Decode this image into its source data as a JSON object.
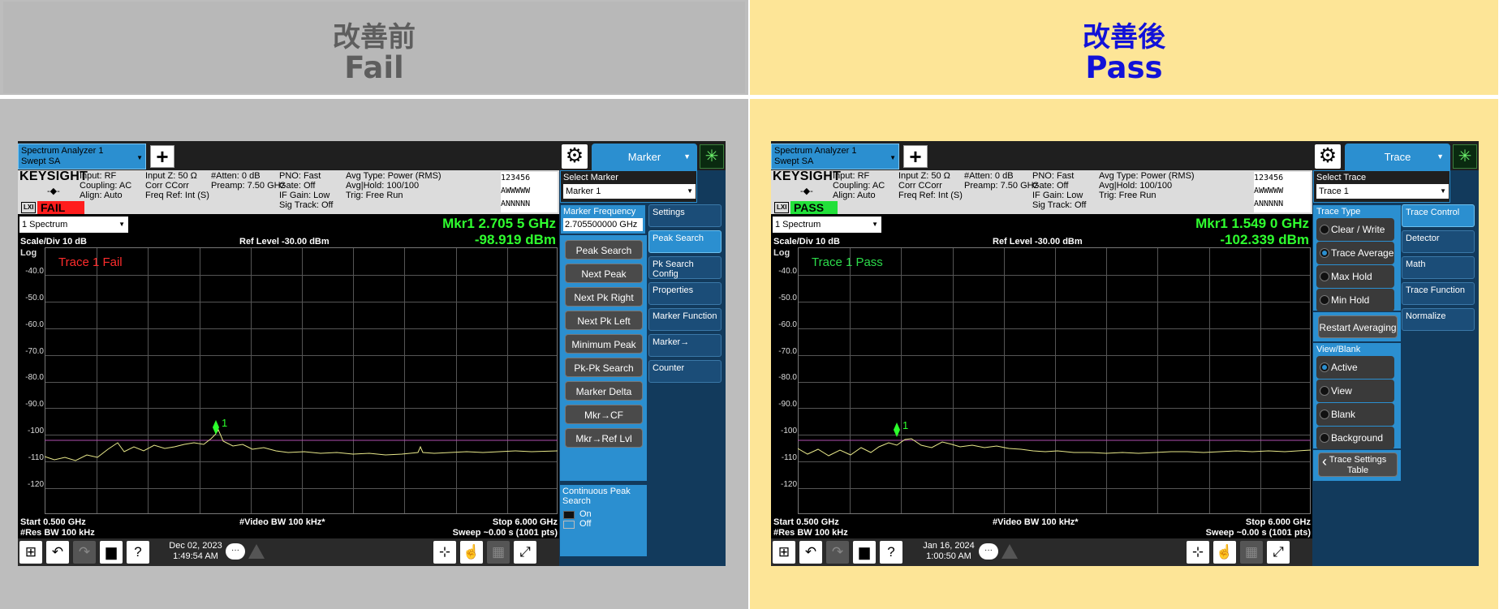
{
  "left": {
    "title_line1": "改善前",
    "title_line2": "Fail",
    "app_tab": "Spectrum Analyzer 1\nSwept SA",
    "menu": "Marker",
    "info": {
      "col1": "Input: RF\nCoupling: AC\nAlign: Auto",
      "col2": "Input Z: 50 Ω\nCorr CCorr\nFreq Ref: Int (S)",
      "col3": "#Atten: 0 dB\nPreamp: 7.50 GHz",
      "col4": "PNO: Fast\nGate: Off\nIF Gain: Low\nSig Track: Off",
      "col5": "Avg Type: Power (RMS)\nAvg|Hold: 100/100\nTrig: Free Run"
    },
    "status_badge": "FAIL",
    "view": "1 Spectrum",
    "marker_freq": "Mkr1  2.705 5 GHz",
    "marker_amp": "-98.919 dBm",
    "trace_label": "Trace 1 Fail",
    "marker_label": "1",
    "date": "Dec 02, 2023",
    "time": "1:49:54 AM",
    "select_title": "Select Marker",
    "select_value": "Marker 1",
    "mf_title": "Marker Frequency",
    "mf_value": "2.705500000 GHz",
    "actions": [
      "Peak Search",
      "Next Peak",
      "Next Pk Right",
      "Next Pk Left",
      "Minimum Peak",
      "Pk-Pk Search",
      "Marker Delta",
      "Mkr→CF",
      "Mkr→Ref Lvl"
    ],
    "cps_title": "Continuous Peak Search",
    "cps_on": "On",
    "cps_off": "Off",
    "tabs": [
      "Settings",
      "Peak Search",
      "Pk Search Config",
      "Properties",
      "Marker Function",
      "Marker→",
      "Counter"
    ]
  },
  "right": {
    "title_line1": "改善後",
    "title_line2": "Pass",
    "app_tab": "Spectrum Analyzer 1\nSwept SA",
    "menu": "Trace",
    "info": {
      "col1": "Input: RF\nCoupling: AC\nAlign: Auto",
      "col2": "Input Z: 50 Ω\nCorr CCorr\nFreq Ref: Int (S)",
      "col3": "#Atten: 0 dB\nPreamp: 7.50 GHz",
      "col4": "PNO: Fast\nGate: Off\nIF Gain: Low\nSig Track: Off",
      "col5": "Avg Type: Power (RMS)\nAvg|Hold: 100/100\nTrig: Free Run"
    },
    "status_badge": "PASS",
    "view": "1 Spectrum",
    "marker_freq": "Mkr1  1.549 0 GHz",
    "marker_amp": "-102.339 dBm",
    "trace_label": "Trace 1 Pass",
    "marker_label": "1",
    "date": "Jan 16, 2024",
    "time": "1:00:50 AM",
    "select_title": "Select Trace",
    "select_value": "Trace 1",
    "trace_type_title": "Trace Type",
    "trace_types": [
      "Clear / Write",
      "Trace Average",
      "Max Hold",
      "Min Hold"
    ],
    "restart": "Restart Averaging",
    "viewblank_title": "View/Blank",
    "viewblank": [
      "Active",
      "View",
      "Blank",
      "Background"
    ],
    "trace_settings": "Trace Settings Table",
    "tabs": [
      "Trace Control",
      "Detector",
      "Math",
      "Trace Function",
      "Normalize"
    ]
  },
  "shared": {
    "brand": "KEYSIGHT",
    "lxi": "LXI",
    "scale": "Scale/Div 10 dB",
    "ref_level": "Ref Level -30.00 dBm",
    "log": "Log",
    "y_ticks": [
      "-40.0",
      "-50.0",
      "-60.0",
      "-70.0",
      "-80.0",
      "-90.0",
      "-100",
      "-110",
      "-120"
    ],
    "start": "Start 0.500 GHz",
    "res_bw": "#Res BW 100 kHz",
    "video_bw": "#Video BW 100 kHz*",
    "stop": "Stop 6.000 GHz",
    "sweep": "Sweep ~0.00 s (1001 pts)",
    "indicator_rows": [
      "123456",
      "AWWWWW",
      "ANNNNN"
    ]
  }
}
